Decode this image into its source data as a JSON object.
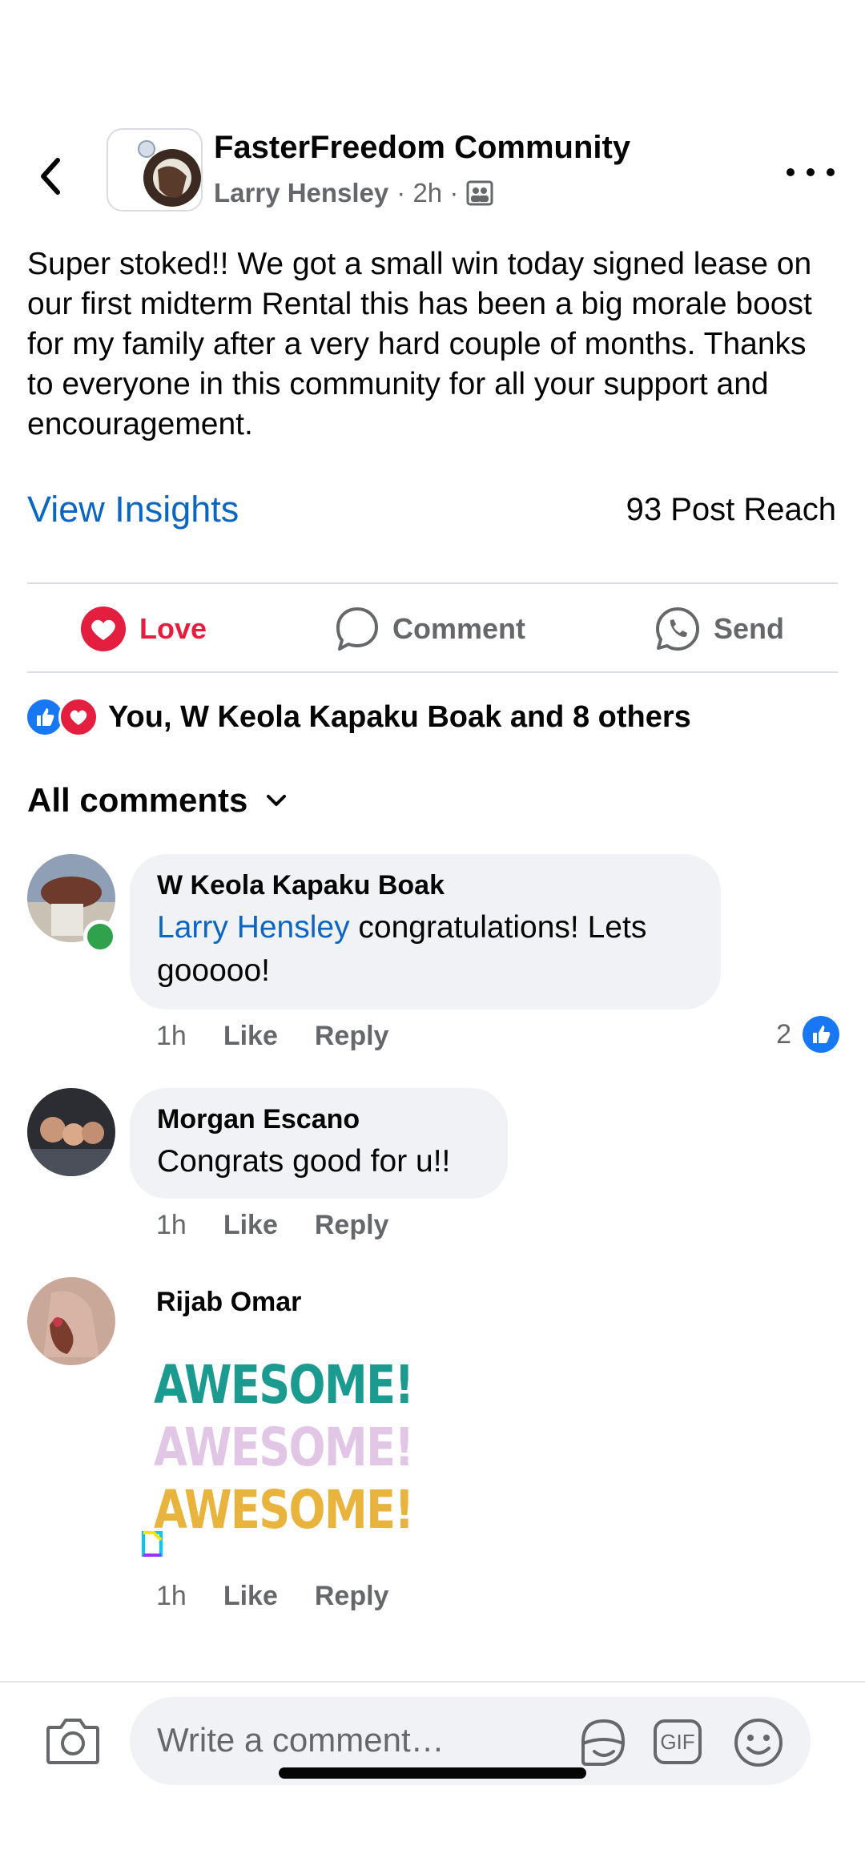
{
  "header": {
    "group_name": "FasterFreedom Community",
    "author": "Larry Hensley",
    "time": "· 2h ·",
    "audience_icon": "group-audience-icon"
  },
  "post": {
    "text": "Super stoked!!  We got a small win today signed lease on our first midterm Rental this has been a big morale boost for my family after a very hard couple of months. Thanks to everyone in this community for all your support and encouragement.",
    "insights_label": "View Insights",
    "reach_label": "93 Post Reach"
  },
  "actions": {
    "love": "Love",
    "comment": "Comment",
    "send": "Send"
  },
  "reactions_summary": "You, W Keola Kapaku Boak and 8 others",
  "comments_header": "All comments",
  "comments": [
    {
      "author": "W Keola Kapaku Boak",
      "mention": "Larry Hensley",
      "text": " congratulations! Lets gooooo!",
      "time": "1h",
      "like": "Like",
      "reply": "Reply",
      "likes": "2"
    },
    {
      "author": "Morgan Escano",
      "text": "Congrats good for u!!",
      "time": "1h",
      "like": "Like",
      "reply": "Reply"
    },
    {
      "author": "Rijab Omar",
      "sticker_lines": [
        "AWESOME!",
        "AWESOME!",
        "AWESOME!"
      ],
      "time": "1h",
      "like": "Like",
      "reply": "Reply"
    }
  ],
  "composer": {
    "placeholder": "Write a comment…",
    "gif_label": "GIF"
  },
  "colors": {
    "accent": "#0a66c2",
    "love": "#e41e3f",
    "like_blue": "#1877f2",
    "bubble": "#f0f2f5",
    "awesome_1": "#1b9a8f",
    "awesome_2": "#e2c6e6",
    "awesome_3": "#e8b43d"
  }
}
